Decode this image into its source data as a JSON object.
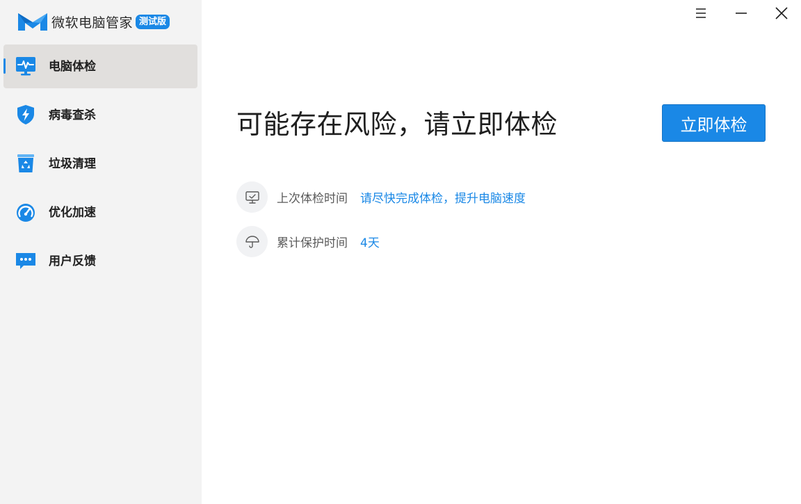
{
  "app": {
    "name": "微软电脑管家",
    "badge": "测试版",
    "brand_color": "#1a88e6"
  },
  "sidebar": {
    "items": [
      {
        "label": "电脑体检",
        "icon": "monitor-pulse-icon",
        "active": true
      },
      {
        "label": "病毒查杀",
        "icon": "shield-bolt-icon",
        "active": false
      },
      {
        "label": "垃圾清理",
        "icon": "recycle-bin-icon",
        "active": false
      },
      {
        "label": "优化加速",
        "icon": "speedometer-icon",
        "active": false
      },
      {
        "label": "用户反馈",
        "icon": "chat-bubble-icon",
        "active": false
      }
    ]
  },
  "window_controls": {
    "menu_icon": "menu-icon",
    "minimize_icon": "minimize-icon",
    "close_icon": "close-icon"
  },
  "main": {
    "headline": "可能存在风险，请立即体检",
    "scan_button_label": "立即体检",
    "rows": [
      {
        "icon": "monitor-check-icon",
        "label": "上次体检时间",
        "value": "请尽快完成体检，提升电脑速度"
      },
      {
        "icon": "umbrella-icon",
        "label": "累计保护时间",
        "value": "4天"
      }
    ]
  }
}
